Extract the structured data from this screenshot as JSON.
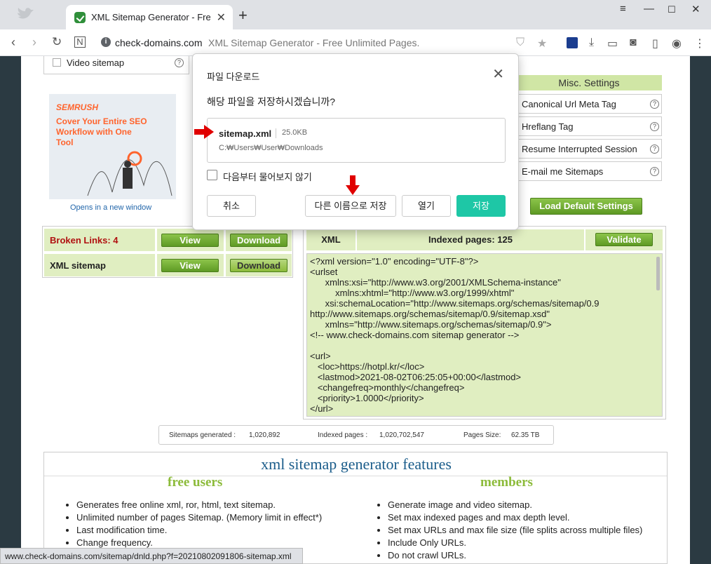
{
  "browser": {
    "tab_title": "XML Sitemap Generator - Free Unlimited Pages.",
    "new_tab": "+",
    "address_domain": "check-domains.com",
    "address_rest": "XML Sitemap Generator - Free Unlimited Pages."
  },
  "left_panel": {
    "video_sitemap_label": "Video sitemap",
    "help": "?"
  },
  "ad": {
    "brand": "SEMRUSH",
    "headline": "Cover Your Entire SEO Workflow with One Tool",
    "link": "Opens in a new window"
  },
  "misc_settings": {
    "title": "Misc. Settings",
    "items": [
      "Canonical Url Meta Tag",
      "Hreflang Tag",
      "Resume Interrupted Session",
      "E-mail me Sitemaps"
    ],
    "help": "?"
  },
  "load_default_label": "Load Default Settings",
  "results": {
    "broken_links_label": "Broken Links: 4",
    "xml_sitemap_label": "XML sitemap",
    "view_label": "View",
    "download_label": "Download"
  },
  "xml_panel": {
    "tab_label": "XML",
    "indexed_label": "Indexed pages: 125",
    "validate_label": "Validate",
    "lines": [
      "<?xml version=\"1.0\" encoding=\"UTF-8\"?>",
      "<urlset",
      "      xmlns:xsi=\"http://www.w3.org/2001/XMLSchema-instance\"",
      "          xmlns:xhtml=\"http://www.w3.org/1999/xhtml\"",
      "      xsi:schemaLocation=\"http://www.sitemaps.org/schemas/sitemap/0.9",
      "http://www.sitemaps.org/schemas/sitemap/0.9/sitemap.xsd\"",
      "      xmlns=\"http://www.sitemaps.org/schemas/sitemap/0.9\">",
      "<!-- www.check-domains.com sitemap generator -->",
      "",
      "<url>",
      "   <loc>https://hotpl.kr/</loc>",
      "   <lastmod>2021-08-02T06:25:05+00:00</lastmod>",
      "   <changefreq>monthly</changefreq>",
      "   <priority>1.0000</priority>",
      "</url>"
    ]
  },
  "stats": {
    "generated_label": "Sitemaps generated :",
    "generated_value": "1,020,892",
    "indexed_label": "Indexed pages :",
    "indexed_value": "1,020,702,547",
    "size_label": "Pages Size:",
    "size_value": "62.35 TB"
  },
  "features": {
    "title": "xml sitemap generator features",
    "free_title": "free users",
    "members_title": "members",
    "free_items": [
      "Generates free online xml, ror, html, text sitemap.",
      "Unlimited number of pages Sitemap. (Memory limit in effect*)",
      "Last modification time.",
      "Change frequency."
    ],
    "member_items": [
      "Generate image and video sitemap.",
      "Set max indexed pages and max depth level.",
      "Set max URLs and max file size (file splits across multiple files)",
      "Include Only URLs.",
      "Do not crawl URLs."
    ]
  },
  "statusbar": "www.check-domains.com/sitemap/dnld.php?f=20210802091806-sitemap.xml",
  "dialog": {
    "title": "파일 다운로드",
    "question": "해당 파일을 저장하시겠습니까?",
    "file_name": "sitemap.xml",
    "file_size": "25.0KB",
    "file_path": "C:₩Users₩User₩Downloads",
    "dont_ask_label": "다음부터 물어보지 않기",
    "cancel_label": "취소",
    "save_as_label": "다른 이름으로 저장",
    "open_label": "열기",
    "save_label": "저장",
    "save_color": "#1ec7a6"
  }
}
